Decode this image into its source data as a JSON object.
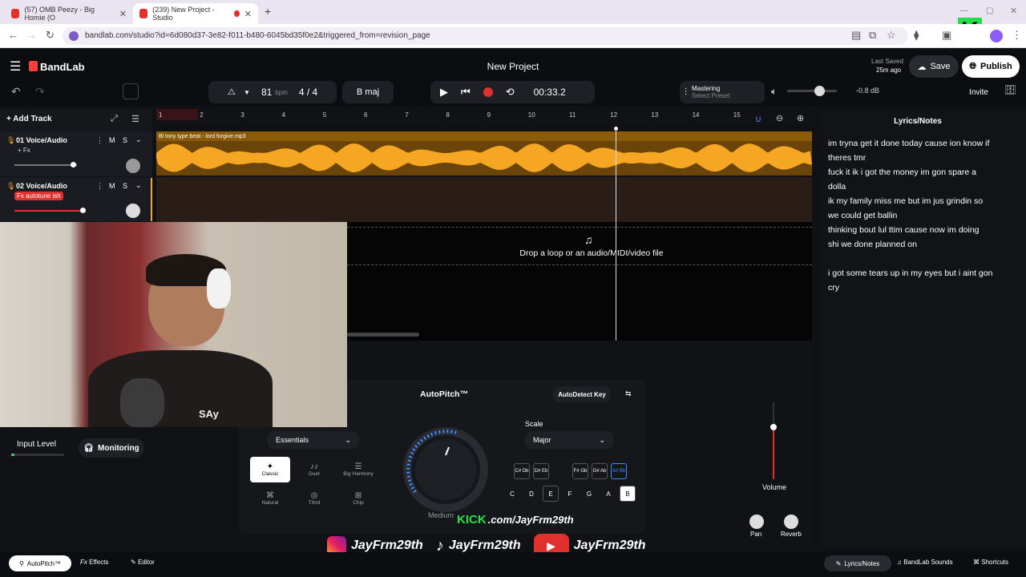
{
  "browser": {
    "tabs": [
      {
        "label": "(57) OMB Peezy - Big Homie (O"
      },
      {
        "label": "(239) New Project - Studio"
      }
    ],
    "url": "bandlab.com/studio?id=6d080d37-3e82-f011-b480-6045bd35f0e2&triggered_from=revision_page"
  },
  "app": {
    "brand": "BandLab",
    "project_title": "New Project",
    "last_saved_label": "Last Saved",
    "last_saved_value": "25m ago",
    "save_label": "Save",
    "publish_label": "Publish",
    "invite_label": "Invite"
  },
  "transport": {
    "bpm": "81",
    "bpm_unit": "bpm",
    "time_sig": "4 / 4",
    "key": "B maj",
    "time": "00:33.2",
    "mastering_label": "Mastering",
    "mastering_preset": "Select Preset",
    "volume_db": "-0.8 dB"
  },
  "tracks": {
    "add_label": "Add Track",
    "items": [
      {
        "name": "01  Voice/Audio",
        "fx": "+ Fx",
        "m": "M",
        "s": "S"
      },
      {
        "name": "02  Voice/Audio",
        "fx": "Fx  autotune ish",
        "m": "M",
        "s": "S"
      }
    ],
    "clip_name": "Bl tony type beat - lord forgive.mp3",
    "ruler": [
      "1",
      "2",
      "3",
      "4",
      "5",
      "6",
      "7",
      "8",
      "9",
      "10",
      "11",
      "12",
      "13",
      "14",
      "15"
    ],
    "drop_text": "Drop a loop or an audio/MIDI/video file"
  },
  "lyrics": {
    "title": "Lyrics/Notes",
    "lines": [
      "im tryna get it done today cause ion know if",
      "theres tmr",
      "fuck it ik i got the money im gon spare a",
      "dolla",
      "ik my family miss me but im jus grindin so",
      "we could get ballin",
      "thinking bout lul ttim cause now im doing",
      "shi we done planned on",
      "",
      "i got some tears up in my eyes but i aint gon",
      "cry"
    ]
  },
  "effects": {
    "input_level_label": "Input Level",
    "monitoring_label": "Monitoring",
    "preset_select": "Essentials",
    "presets": [
      "Classic",
      "Duet",
      "Big Harmony",
      "Natural",
      "Third",
      "Chip"
    ],
    "autopitch_title": "AutoPitch™",
    "autodetect_label": "AutoDetect Key",
    "scale_label": "Scale",
    "scale_value": "Major",
    "dial_label": "Medium",
    "sharp_keys": [
      "C# Db",
      "D# Eb",
      "F# Gb",
      "G# Ab",
      "A# Bb"
    ],
    "natural_keys": [
      "C",
      "D",
      "E",
      "F",
      "G",
      "A",
      "B"
    ],
    "volume_label": "Volume",
    "pan_label": "Pan",
    "reverb_label": "Reverb"
  },
  "overlay": {
    "kick_brand": "KICK",
    "kick_url": ".com/JayFrm29th",
    "handles": [
      "JayFrm29th",
      "JayFrm29th",
      "JayFrm29th"
    ],
    "shirt_text": "SAy"
  },
  "footer": {
    "autopitch_tab": "AutoPitch™",
    "effects_tab": "Effects",
    "editor_tab": "Editor",
    "lyrics_tab": "Lyrics/Notes",
    "sounds_tab": "BandLab Sounds",
    "shortcuts_tab": "Shortcuts"
  },
  "colors": {
    "accent": "#f5a623",
    "record": "#e0312f",
    "brand": "#ff3d3d"
  }
}
